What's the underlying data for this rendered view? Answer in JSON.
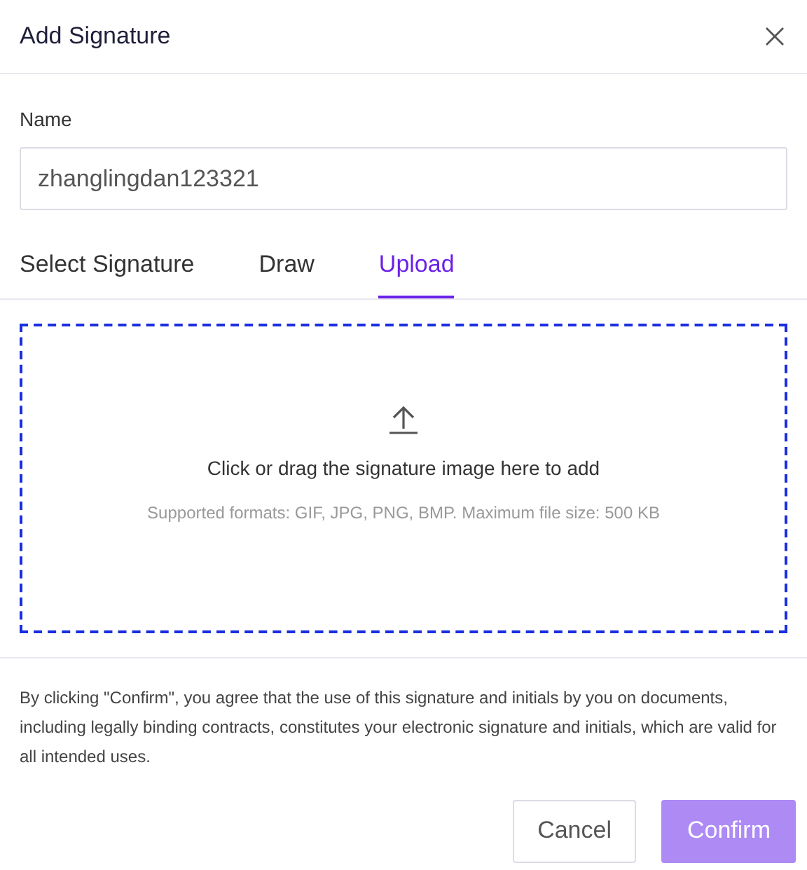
{
  "dialog": {
    "title": "Add Signature"
  },
  "name_field": {
    "label": "Name",
    "value": "zhanglingdan123321"
  },
  "tabs": [
    {
      "label": "Select Signature",
      "selected": false
    },
    {
      "label": "Draw",
      "selected": false
    },
    {
      "label": "Upload",
      "selected": true
    }
  ],
  "upload": {
    "prompt": "Click or drag the signature image here to add",
    "hint": "Supported formats: GIF, JPG, PNG, BMP. Maximum file size: 500 KB"
  },
  "notice": "By clicking \"Confirm\", you agree that the use of this signature and initials by you on documents, including legally binding contracts, constitutes your electronic signature and initials, which are valid for all intended uses.",
  "buttons": [
    {
      "label": "Cancel",
      "kind": "secondary",
      "disabled": false
    },
    {
      "label": "Confirm",
      "kind": "primary",
      "disabled": true
    }
  ]
}
